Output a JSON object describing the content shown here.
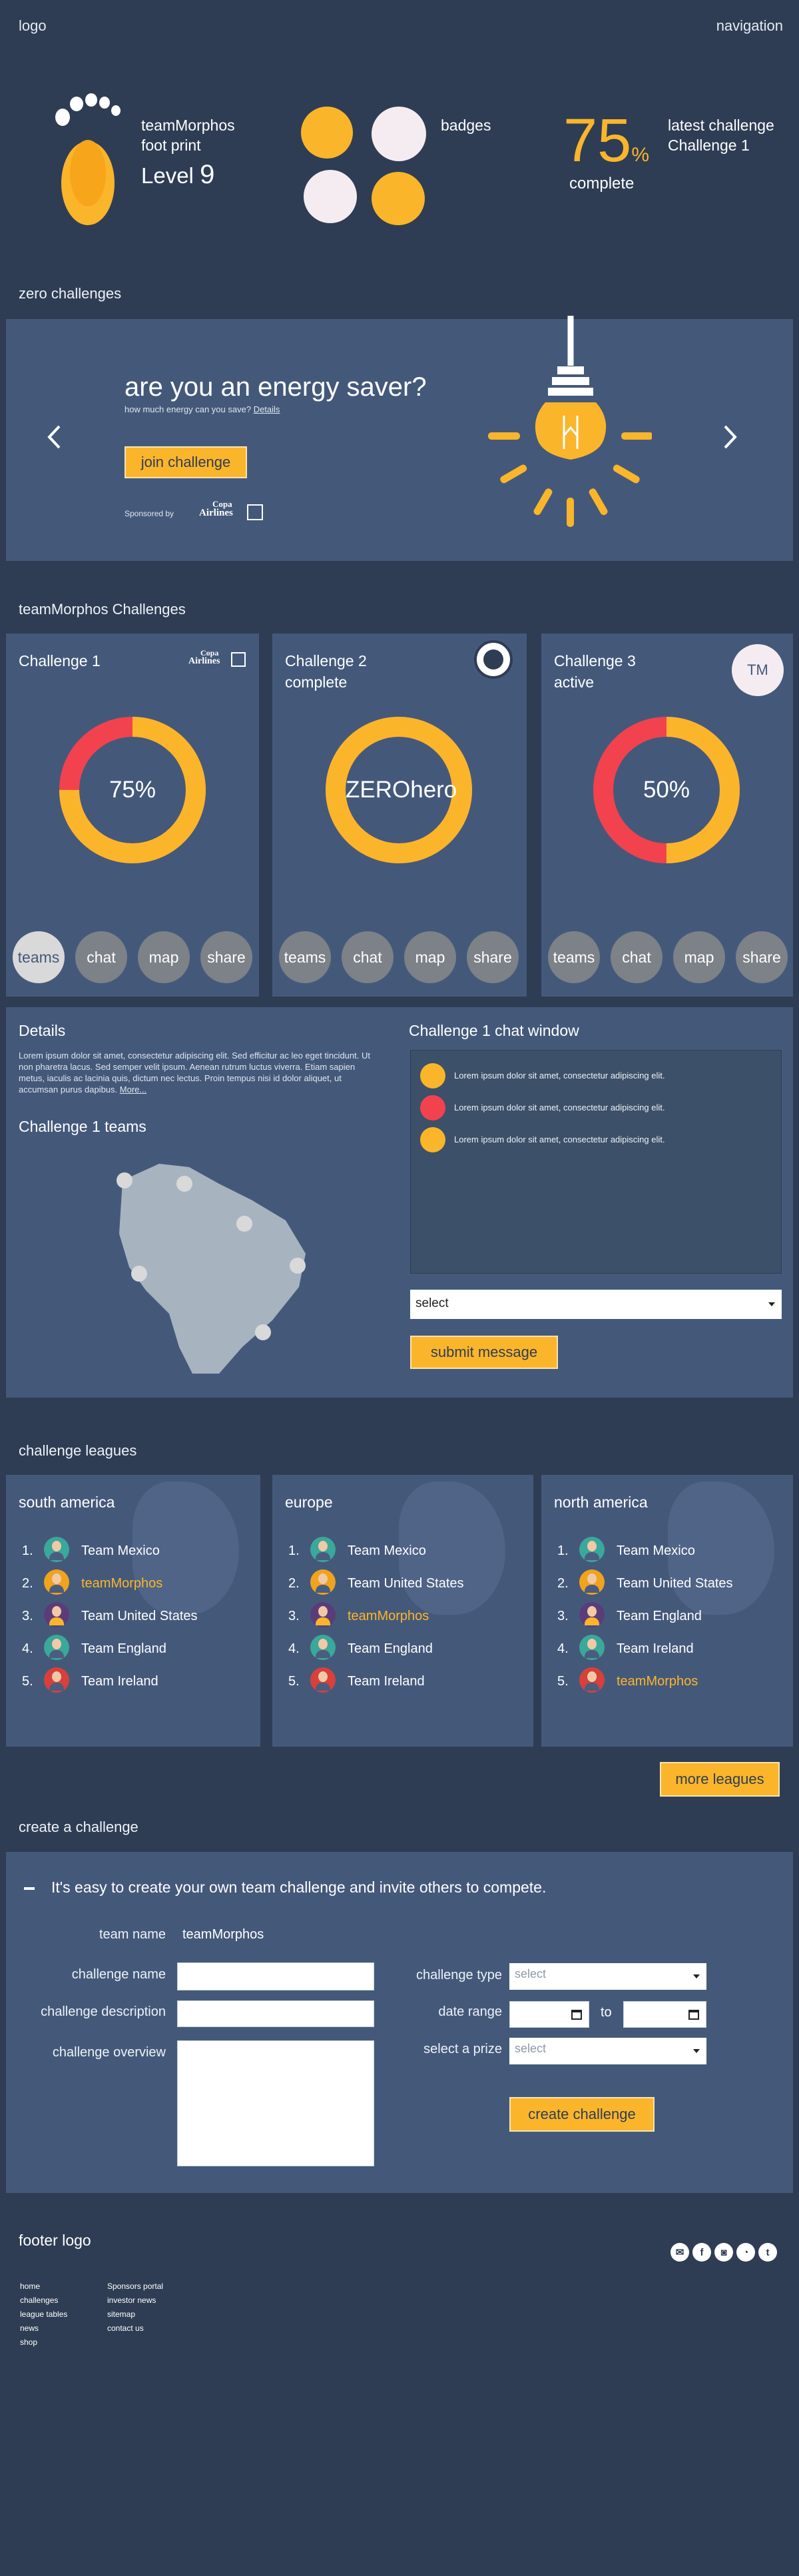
{
  "header": {
    "logo": "logo",
    "navigation": "navigation"
  },
  "profile": {
    "team_name": "teamMorphos",
    "foot_print": "foot print",
    "level_label": "Level",
    "level_value": "9",
    "badges_label": "badges",
    "progress_value": "75",
    "progress_unit": "%",
    "progress_label": "complete",
    "latest_challenge_label": "latest challenge",
    "latest_challenge_name": "Challenge 1",
    "colors": {
      "yellow": "#fbb52b",
      "badge_white": "#f5ecf2"
    }
  },
  "zero_challenges": {
    "section_title": "zero challenges",
    "headline": "are you an energy saver?",
    "subtext": "how much energy can you save?",
    "details_link": "Details",
    "join_button": "join challenge",
    "sponsored_by": "Sponsored by",
    "sponsor_logo_line1": "Copa",
    "sponsor_logo_line2": "Airlines",
    "prev_icon": "chevron-left-icon",
    "next_icon": "chevron-right-icon",
    "illustration": "lightbulb-icon"
  },
  "team_challenges": {
    "section_title": "teamMorphos Challenges",
    "cards": [
      {
        "title": "Challenge 1",
        "status": "",
        "center_text": "75%",
        "percent": 75,
        "sponsor_line1": "Copa",
        "sponsor_line2": "Airlines",
        "ring_color": "#fbb52b",
        "rest_color": "#f2424e"
      },
      {
        "title": "Challenge 2",
        "status": "complete",
        "center_text": "ZEROhero",
        "percent": 100,
        "sponsor_logo": "starbucks-logo",
        "ring_color": "#fbb52b",
        "rest_color": "#f2424e"
      },
      {
        "title": "Challenge 3",
        "status": "active",
        "center_text": "50%",
        "percent": 50,
        "avatar_text": "TM",
        "ring_color": "#fbb52b",
        "rest_color": "#f2424e"
      }
    ],
    "actions": [
      "teams",
      "chat",
      "map",
      "share"
    ]
  },
  "details": {
    "title": "Details",
    "body": "Lorem ipsum dolor sit amet, consectetur adipiscing elit. Sed efficitur ac leo eget tincidunt. Ut non pharetra lacus. Sed semper velit ipsum. Aenean rutrum luctus viverra. Etiam sapien metus, iaculis ac lacinia quis, dictum nec lectus. Proin tempus nisi id dolor aliquet, ut accumsan purus dapibus.",
    "more_link": "More...",
    "teams_title": "Challenge 1 teams",
    "map_icon": "south-america-map"
  },
  "chat": {
    "title": "Challenge 1 chat window",
    "messages": [
      {
        "text": "Lorem ipsum dolor sit amet, consectetur adipiscing elit.",
        "color": "#fbb52b"
      },
      {
        "text": "Lorem ipsum dolor sit amet, consectetur adipiscing elit.",
        "color": "#f2424e"
      },
      {
        "text": "Lorem ipsum dolor sit amet, consectetur adipiscing elit.",
        "color": "#fbb52b"
      }
    ],
    "select_value": "select",
    "submit_button": "submit message"
  },
  "leagues": {
    "section_title": "challenge leagues",
    "more_button": "more leagues",
    "groups": [
      {
        "region": "south america",
        "teams": [
          {
            "rank": "1.",
            "name": "Team Mexico",
            "highlight": false,
            "avatar_bg": "#3aa89a",
            "shirt": "#4a5d7e"
          },
          {
            "rank": "2.",
            "name": "teamMorphos",
            "highlight": true,
            "avatar_bg": "#f0a31d",
            "shirt": "#4a5d7e"
          },
          {
            "rank": "3.",
            "name": "Team United States",
            "highlight": false,
            "avatar_bg": "#5b3c7a",
            "shirt": "#fbb52b"
          },
          {
            "rank": "4.",
            "name": "Team England",
            "highlight": false,
            "avatar_bg": "#3aa89a",
            "shirt": "#4a5d7e"
          },
          {
            "rank": "5.",
            "name": "Team Ireland",
            "highlight": false,
            "avatar_bg": "#d8403c",
            "shirt": "#4a5d7e"
          }
        ]
      },
      {
        "region": "europe",
        "teams": [
          {
            "rank": "1.",
            "name": "Team Mexico",
            "highlight": false,
            "avatar_bg": "#3aa89a",
            "shirt": "#4a5d7e"
          },
          {
            "rank": "2.",
            "name": "Team United States",
            "highlight": false,
            "avatar_bg": "#f0a31d",
            "shirt": "#4a5d7e"
          },
          {
            "rank": "3.",
            "name": "teamMorphos",
            "highlight": true,
            "avatar_bg": "#5b3c7a",
            "shirt": "#fbb52b"
          },
          {
            "rank": "4.",
            "name": "Team England",
            "highlight": false,
            "avatar_bg": "#3aa89a",
            "shirt": "#4a5d7e"
          },
          {
            "rank": "5.",
            "name": "Team Ireland",
            "highlight": false,
            "avatar_bg": "#d8403c",
            "shirt": "#4a5d7e"
          }
        ]
      },
      {
        "region": "north america",
        "teams": [
          {
            "rank": "1.",
            "name": "Team Mexico",
            "highlight": false,
            "avatar_bg": "#3aa89a",
            "shirt": "#4a5d7e"
          },
          {
            "rank": "2.",
            "name": "Team United States",
            "highlight": false,
            "avatar_bg": "#f0a31d",
            "shirt": "#4a5d7e"
          },
          {
            "rank": "3.",
            "name": "Team England",
            "highlight": false,
            "avatar_bg": "#5b3c7a",
            "shirt": "#fbb52b"
          },
          {
            "rank": "4.",
            "name": "Team Ireland",
            "highlight": false,
            "avatar_bg": "#3aa89a",
            "shirt": "#4a5d7e"
          },
          {
            "rank": "5.",
            "name": "teamMorphos",
            "highlight": true,
            "avatar_bg": "#d8403c",
            "shirt": "#4a5d7e"
          }
        ]
      }
    ]
  },
  "create": {
    "section_title": "create a challenge",
    "collapse_icon": "minus-icon",
    "intro": "It's easy to create your own team challenge and invite others to compete.",
    "team_name_label": "team name",
    "team_name_value": "teamMorphos",
    "challenge_name_label": "challenge name",
    "challenge_description_label": "challenge description",
    "challenge_overview_label": "challenge overview",
    "challenge_type_label": "challenge type",
    "challenge_type_value": "select",
    "date_range_label": "date range",
    "date_to": "to",
    "prize_label": "select a prize",
    "prize_value": "select",
    "submit_button": "create challenge"
  },
  "footer": {
    "logo": "footer logo",
    "col1": [
      "home",
      "challenges",
      "league tables",
      "news",
      "shop"
    ],
    "col2": [
      "Sponsors portal",
      "investor news",
      "sitemap",
      "contact us"
    ],
    "social": [
      "mail-icon",
      "facebook-icon",
      "instagram-icon",
      "rss-icon",
      "twitter-icon"
    ]
  }
}
